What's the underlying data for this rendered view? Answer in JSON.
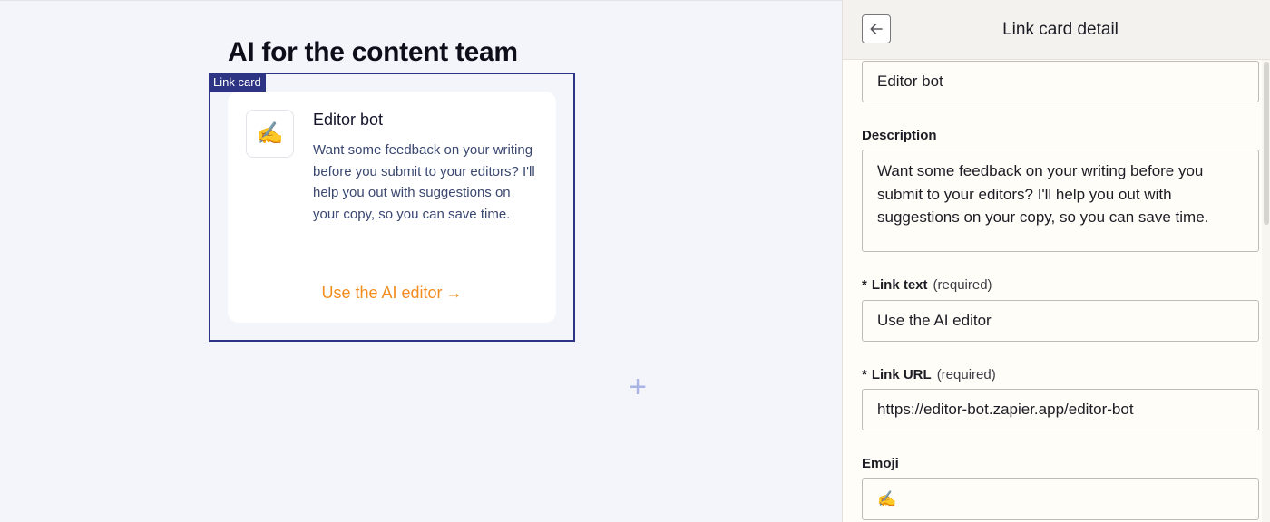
{
  "canvas": {
    "page_title": "AI for the content team",
    "selection_tag": "Link card",
    "card": {
      "emoji": "✍️",
      "title": "Editor bot",
      "description": "Want some feedback on your writing before you submit to your editors? I'll help you out with suggestions on your copy, so you can save time.",
      "link_text": "Use the AI editor",
      "link_arrow": "→"
    },
    "add_block_icon": "+"
  },
  "panel": {
    "title": "Link card detail",
    "back_icon": "arrow-left-icon",
    "fields": {
      "title_value": "Editor bot",
      "description_label": "Description",
      "description_value": "Want some feedback on your writing before you submit to your editors? I'll help you out with suggestions on your copy, so you can save time.",
      "link_text_label": "Link text",
      "link_text_required": "(required)",
      "link_text_value": "Use the AI editor",
      "link_url_label": "Link URL",
      "link_url_required": "(required)",
      "link_url_value": "https://editor-bot.zapier.app/editor-bot",
      "emoji_label": "Emoji",
      "emoji_value": "✍️",
      "required_marker": "*"
    }
  },
  "colors": {
    "accent_orange": "#f28c1e",
    "selection_navy": "#2d3483",
    "canvas_bg": "#f4f5fa",
    "panel_bg": "#fffdf7"
  }
}
